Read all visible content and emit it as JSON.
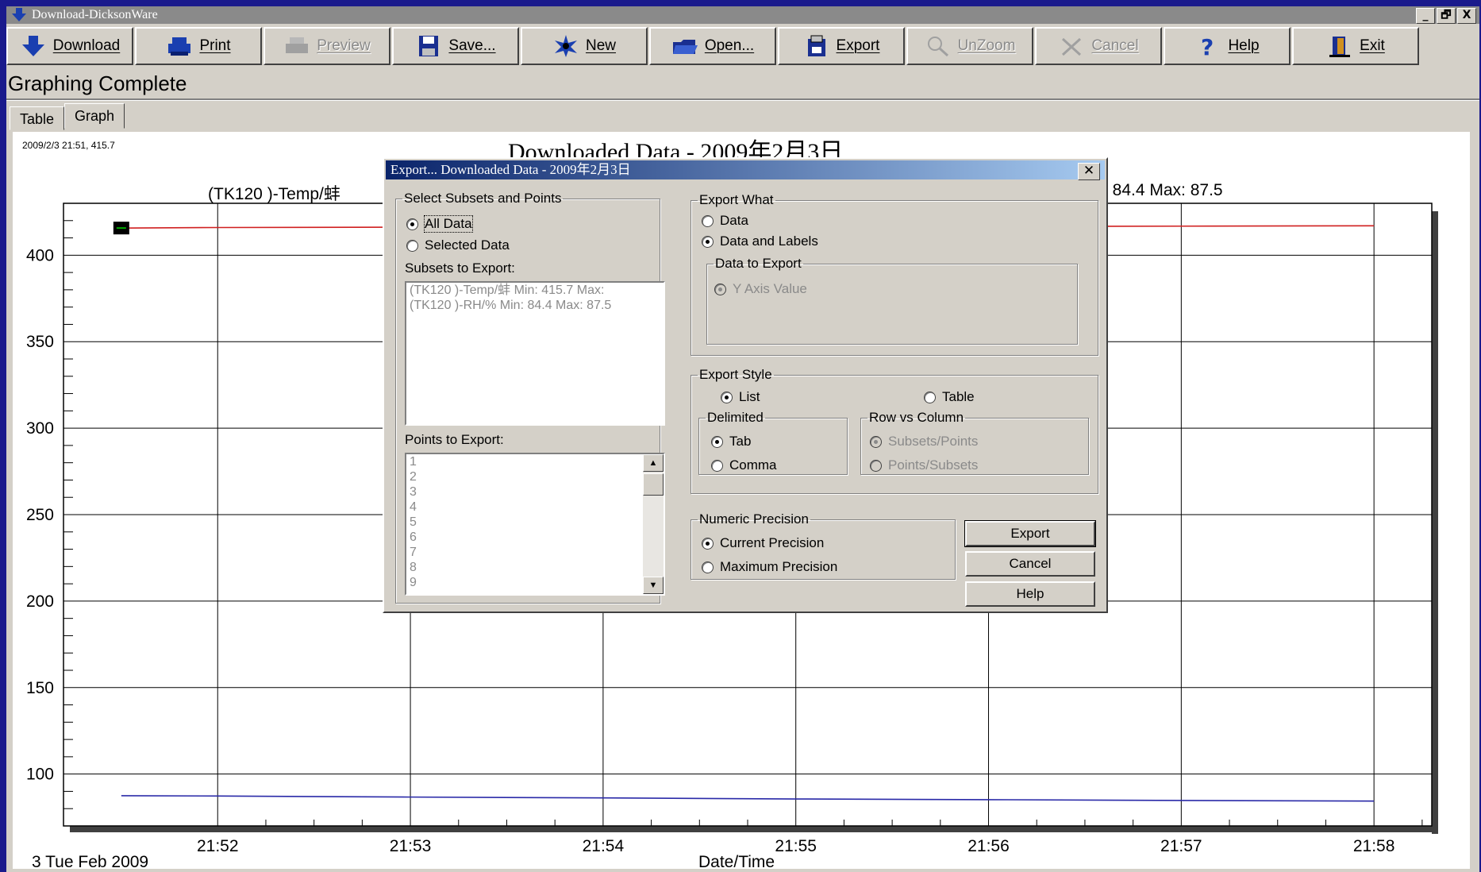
{
  "window": {
    "title": "Download-DicksonWare",
    "min_glyph": "_",
    "restore_glyph": "🗗",
    "close_glyph": "X"
  },
  "toolbar": [
    {
      "label": "Download",
      "icon": "download-arrow-icon",
      "enabled": true
    },
    {
      "label": "Print",
      "icon": "printer-icon",
      "enabled": true
    },
    {
      "label": "Preview",
      "icon": "preview-printer-icon",
      "enabled": false
    },
    {
      "label": "Save...",
      "icon": "floppy-disk-icon",
      "enabled": true
    },
    {
      "label": "New",
      "icon": "new-spark-icon",
      "enabled": true
    },
    {
      "label": "Open...",
      "icon": "open-folder-icon",
      "enabled": true
    },
    {
      "label": "Export",
      "icon": "export-icon",
      "enabled": true
    },
    {
      "label": "UnZoom",
      "icon": "magnifier-icon",
      "enabled": false
    },
    {
      "label": "Cancel",
      "icon": "cancel-icon",
      "enabled": false
    },
    {
      "label": "Help",
      "icon": "help-question-icon",
      "enabled": true
    },
    {
      "label": "Exit",
      "icon": "exit-door-icon",
      "enabled": true
    }
  ],
  "status": "Graphing Complete",
  "tabs": [
    {
      "label": "Table",
      "active": false
    },
    {
      "label": "Graph",
      "active": true
    }
  ],
  "graph": {
    "coords_readout": "2009/2/3 21:51, 415.7",
    "title": "Downloaded Data - 2009年2月3日",
    "legend_left": "(TK120   )-Temp/蚌",
    "legend_right": ": 84.4 Max: 87.5",
    "x_date_label": "3 Tue Feb 2009",
    "x_axis_title": "Date/Time"
  },
  "chart_data": {
    "type": "line",
    "xlabel": "Date/Time",
    "x_ticks": [
      "21:52",
      "21:53",
      "21:54",
      "21:55",
      "21:56",
      "21:57",
      "21:58"
    ],
    "y_ticks": [
      100,
      150,
      200,
      250,
      300,
      350,
      400
    ],
    "ylim": [
      70,
      430
    ],
    "xlim": [
      "21:51.2",
      "21:58.3"
    ],
    "grid": true,
    "series": [
      {
        "name": "(TK120   )-Temp/蚌",
        "color": "#d02020",
        "x": [
          "21:51.5",
          "21:52",
          "21:53",
          "21:54",
          "21:55",
          "21:56",
          "21:57",
          "21:58"
        ],
        "values": [
          415.7,
          416,
          416.2,
          416.4,
          416.5,
          416.6,
          416.8,
          417
        ]
      },
      {
        "name": "(TK120   )-RH/%",
        "color": "#2a2aa8",
        "x": [
          "21:51.5",
          "21:52",
          "21:53",
          "21:54",
          "21:55",
          "21:56",
          "21:57",
          "21:58"
        ],
        "values": [
          87.5,
          87.3,
          86.7,
          86.2,
          85.6,
          85.2,
          84.7,
          84.4
        ]
      }
    ]
  },
  "dialog": {
    "title": "Export... Downloaded Data - 2009年2月3日",
    "close_glyph": "✕",
    "subsets_group": "Select Subsets and Points",
    "all_data": "All Data",
    "selected_data": "Selected Data",
    "subsets_label": "Subsets to Export:",
    "subsets": [
      "(TK120   )-Temp/蚌  Min: 415.7 Max:",
      "(TK120   )-RH/%  Min: 84.4  Max: 87.5"
    ],
    "points_label": "Points to Export:",
    "points": [
      "1",
      "2",
      "3",
      "4",
      "5",
      "6",
      "7",
      "8",
      "9"
    ],
    "scroll_up": "▲",
    "scroll_down": "▼",
    "export_what": "Export What",
    "opt_data": "Data",
    "opt_data_labels": "Data and Labels",
    "data_to_export": "Data to Export",
    "y_axis_value": "Y Axis Value",
    "export_style": "Export Style",
    "opt_list": "List",
    "opt_table": "Table",
    "delimited": "Delimited",
    "opt_tab": "Tab",
    "opt_comma": "Comma",
    "row_vs_column": "Row vs Column",
    "opt_subsets_points": "Subsets/Points",
    "opt_points_subsets": "Points/Subsets",
    "numeric_precision": "Numeric Precision",
    "opt_current": "Current Precision",
    "opt_maximum": "Maximum Precision",
    "btn_export": "Export",
    "btn_cancel": "Cancel",
    "btn_help": "Help"
  }
}
